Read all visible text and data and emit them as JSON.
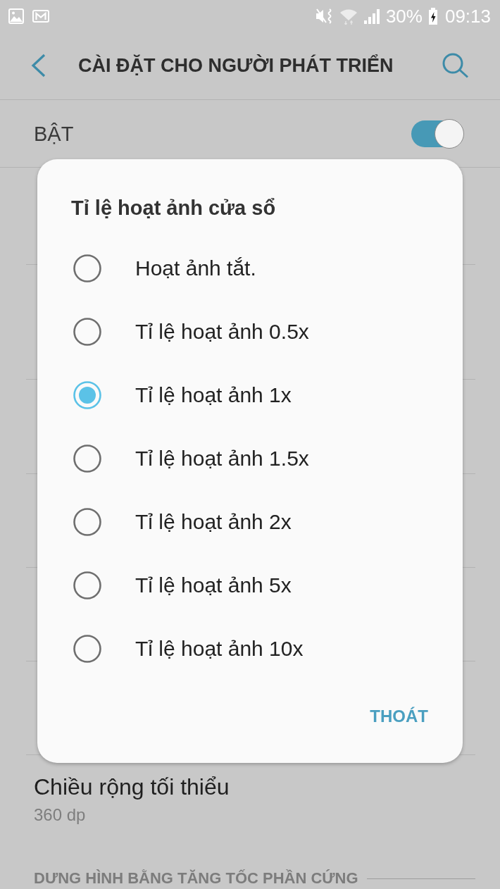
{
  "status_bar": {
    "battery": "30%",
    "time": "09:13"
  },
  "header": {
    "title": "CÀI ĐẶT CHO NGƯỜI PHÁT TRIỂN"
  },
  "master_switch": {
    "label": "BẬT",
    "on": true
  },
  "settings": [
    {
      "title": "Chiều rộng tối thiểu",
      "value": "360 dp"
    }
  ],
  "section": {
    "title": "DƯNG HÌNH BẰNG TĂNG TỐC PHẦN CỨNG"
  },
  "dialog": {
    "title": "Tỉ lệ hoạt ảnh cửa sổ",
    "options": [
      {
        "label": "Hoạt ảnh tắt.",
        "selected": false
      },
      {
        "label": "Tỉ lệ hoạt ảnh 0.5x",
        "selected": false
      },
      {
        "label": "Tỉ lệ hoạt ảnh 1x",
        "selected": true
      },
      {
        "label": "Tỉ lệ hoạt ảnh 1.5x",
        "selected": false
      },
      {
        "label": "Tỉ lệ hoạt ảnh 2x",
        "selected": false
      },
      {
        "label": "Tỉ lệ hoạt ảnh 5x",
        "selected": false
      },
      {
        "label": "Tỉ lệ hoạt ảnh 10x",
        "selected": false
      }
    ],
    "buttons": [
      "THOÁT"
    ]
  }
}
